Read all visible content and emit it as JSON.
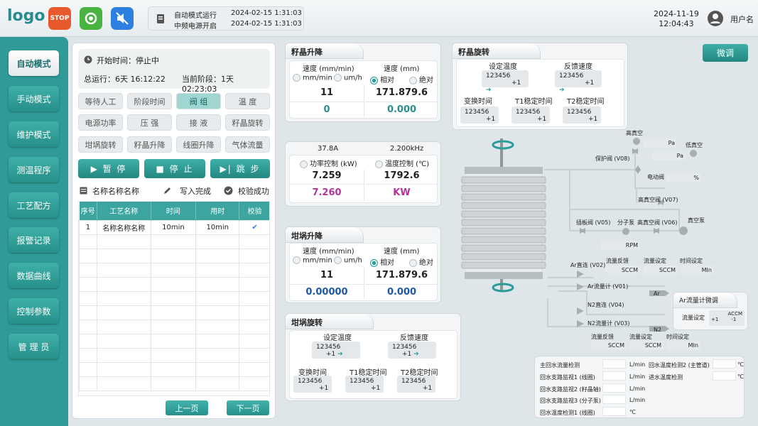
{
  "topbar": {
    "logo": "logo",
    "icons": [
      "stop-icon",
      "power-icon",
      "mute-icon"
    ],
    "status_lines": [
      {
        "label": "自动模式运行",
        "time": "2024-02-15  1:31:03"
      },
      {
        "label": "中频电源开启",
        "time": "2024-02-15  1:31:03"
      }
    ],
    "date": "2024-11-19",
    "time": "12:04:43",
    "user": "用户名"
  },
  "sidebar": {
    "items": [
      "自动模式",
      "手动模式",
      "维护模式",
      "测温程序",
      "工艺配方",
      "报警记录",
      "数据曲线",
      "控制参数",
      "管 理 员"
    ]
  },
  "left": {
    "start_label": "开始时间：停止中",
    "total_label": "总运行：6天  16:12:22",
    "stage_label": "当前阶段：1天  02:23:03",
    "tags": [
      "等待人工",
      "阶段时间",
      "阀 组",
      "温 度",
      "电源功率",
      "压 强",
      "接 液",
      "籽晶旋转",
      "坩埚旋转",
      "籽晶升降",
      "线圈升降",
      "气体流量"
    ],
    "buttons": [
      "▶  暂 停",
      "■  停 止",
      "▶|  跳 步"
    ],
    "recipe_name": "名称名称名称",
    "write_status": "写入完成",
    "check_status": "校验成功",
    "table_headers": [
      "序号",
      "工艺名称",
      "时间",
      "用时",
      "校验"
    ],
    "rows": [
      {
        "no": "1",
        "name": "名称名称名称",
        "time": "10min",
        "used": "10min",
        "check": "✔"
      }
    ],
    "prev": "上一页",
    "next": "下一页"
  },
  "seed_lift": {
    "title": "籽晶升降",
    "speed1": "速度 (mm/min)",
    "speed2": "速度 (mm)",
    "r1": "mm/min",
    "r2": "um/h",
    "r3": "相对",
    "r4": "绝对",
    "v1": "11",
    "v2": "171.879.6",
    "v3": "0",
    "v4": "0.000"
  },
  "power": {
    "current": "37.8A",
    "freq": "2.200kHz",
    "mode1": "功率控制 (kW)",
    "mode2": "温度控制 (℃)",
    "v1": "7.259",
    "v2": "1792.6",
    "v3": "7.260",
    "v4": "KW"
  },
  "crucible_lift": {
    "title": "坩埚升降",
    "speed1": "速度 (mm/min)",
    "speed2": "速度 (mm)",
    "r1": "mm/min",
    "r2": "um/h",
    "r3": "相对",
    "r4": "绝对",
    "v1": "11",
    "v2": "171.879.6",
    "v3": "0.00000",
    "v4": "0.000"
  },
  "crucible_rot": {
    "title": "坩埚旋转",
    "set_temp": "设定温度",
    "fb_speed": "反馈速度",
    "val": "123456",
    "inc": "+1",
    "switch_time": "变换时间",
    "t1": "T1稳定时间",
    "t2": "T2稳定时间"
  },
  "seed_rot": {
    "title": "籽晶旋转",
    "set_temp": "设定温度",
    "fb_speed": "反馈速度",
    "val": "123456",
    "inc": "+1",
    "switch_time": "变换时间",
    "t1": "T1稳定时间",
    "t2": "T2稳定时间"
  },
  "micro_btn": "微调",
  "diagram": {
    "high_vac": "高真空",
    "pa": "Pa",
    "low_vac": "低真空",
    "protect_valve": "保护阀 (V08)",
    "elec_valve": "电动阀",
    "pct": "%",
    "hv_valve1": "高真空阀 (V07)",
    "plate_valve": "插板阀 (V05)",
    "mol_pump": "分子泵",
    "hv_valve2": "高真空阀 (V06)",
    "vac_pump": "真空泵",
    "rpm": "RPM",
    "ar_direct": "Ar直连 (V02)",
    "ar_flow": "Ar流量计 (V01)",
    "n2_direct": "N2直连 (V04)",
    "n2_flow": "N2流量计 (V03)",
    "flow_fb": "流量反馈",
    "flow_set": "流量设定",
    "time_set": "时间设定",
    "sccm": "SCCM",
    "min": "MIn",
    "ar": "Ar",
    "n2": "N2",
    "ar_tune_title": "Ar流量计微调",
    "flow_set2": "流量设定",
    "accm": "ACCM",
    "plus": "+1",
    "minus": "-1"
  },
  "water": {
    "rows": [
      {
        "label": "主回水流量检测",
        "unit": "L/min"
      },
      {
        "label": "回水支路监视1 (线圈)",
        "unit": "L/min"
      },
      {
        "label": "回水支路监视2 (籽晶轴)",
        "unit": "L/min"
      },
      {
        "label": "回水支路监视3 (分子泵)",
        "unit": "L/min"
      },
      {
        "label": "回水温度检测1 (线圈)",
        "unit": "℃"
      }
    ],
    "right": [
      {
        "label": "回水温度检测2 (主管道)",
        "unit": "℃"
      },
      {
        "label": "进水温度检测",
        "unit": "℃"
      }
    ]
  }
}
